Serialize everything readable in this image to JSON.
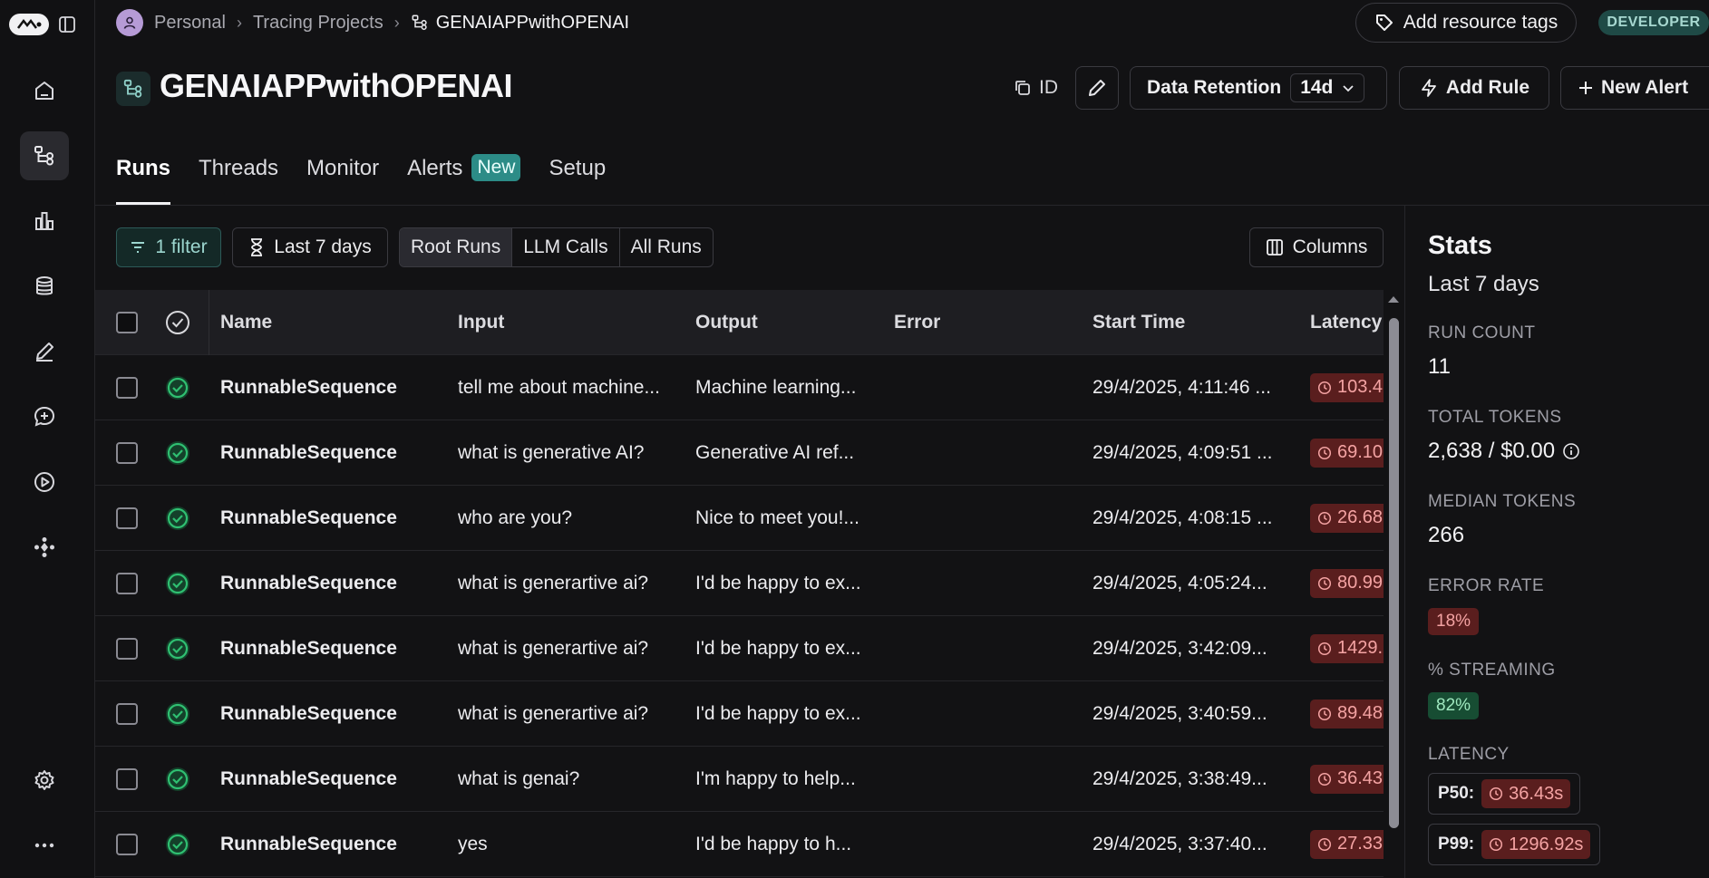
{
  "breadcrumb": {
    "workspace": "Personal",
    "section": "Tracing Projects",
    "project": "GENAIAPPwithOPENAI"
  },
  "header": {
    "resource_tags_label": "Add resource tags",
    "env_badge": "DEVELOPER",
    "title": "GENAIAPPwithOPENAI",
    "id_label": "ID",
    "retention_label": "Data Retention",
    "retention_value": "14d",
    "add_rule_label": "Add Rule",
    "new_alert_label": "New Alert"
  },
  "tabs": [
    {
      "label": "Runs",
      "active": true
    },
    {
      "label": "Threads"
    },
    {
      "label": "Monitor"
    },
    {
      "label": "Alerts",
      "badge": "New"
    },
    {
      "label": "Setup"
    }
  ],
  "toolbar": {
    "filter_label": "1 filter",
    "range_label": "Last 7 days",
    "run_types": [
      "Root Runs",
      "LLM Calls",
      "All Runs"
    ],
    "selected_run_type": "Root Runs",
    "columns_label": "Columns"
  },
  "table": {
    "columns": [
      "Name",
      "Input",
      "Output",
      "Error",
      "Start Time",
      "Latency"
    ],
    "rows": [
      {
        "name": "RunnableSequence",
        "input": "tell me about machine...",
        "output": "Machine learning...",
        "error": "",
        "start": "29/4/2025, 4:11:46 ...",
        "latency": "103.4"
      },
      {
        "name": "RunnableSequence",
        "input": "what is generative AI?",
        "output": "Generative AI ref...",
        "error": "",
        "start": "29/4/2025, 4:09:51 ...",
        "latency": "69.10"
      },
      {
        "name": "RunnableSequence",
        "input": "who are you?",
        "output": "Nice to meet you!...",
        "error": "",
        "start": "29/4/2025, 4:08:15 ...",
        "latency": "26.68"
      },
      {
        "name": "RunnableSequence",
        "input": "what is generartive ai?",
        "output": "I'd be happy to ex...",
        "error": "",
        "start": "29/4/2025, 4:05:24...",
        "latency": "80.99"
      },
      {
        "name": "RunnableSequence",
        "input": "what is generartive ai?",
        "output": "I'd be happy to ex...",
        "error": "",
        "start": "29/4/2025, 3:42:09...",
        "latency": "1429."
      },
      {
        "name": "RunnableSequence",
        "input": "what is generartive ai?",
        "output": "I'd be happy to ex...",
        "error": "",
        "start": "29/4/2025, 3:40:59...",
        "latency": "89.48"
      },
      {
        "name": "RunnableSequence",
        "input": "what is genai?",
        "output": "I'm happy to help...",
        "error": "",
        "start": "29/4/2025, 3:38:49...",
        "latency": "36.43"
      },
      {
        "name": "RunnableSequence",
        "input": "yes",
        "output": "I'd be happy to h...",
        "error": "",
        "start": "29/4/2025, 3:37:40...",
        "latency": "27.33"
      }
    ]
  },
  "stats": {
    "title": "Stats",
    "range": "Last 7 days",
    "run_count_label": "RUN COUNT",
    "run_count": "11",
    "total_tokens_label": "TOTAL TOKENS",
    "total_tokens": "2,638 / $0.00",
    "median_tokens_label": "MEDIAN TOKENS",
    "median_tokens": "266",
    "error_rate_label": "ERROR RATE",
    "error_rate": "18%",
    "streaming_label": "% STREAMING",
    "streaming": "82%",
    "latency_label": "LATENCY",
    "p50_label": "P50:",
    "p50": "36.43s",
    "p99_label": "P99:",
    "p99": "1296.92s"
  },
  "colors": {
    "background": "#121214",
    "accent_teal": "#2c8c87",
    "success_green": "#2fbf71",
    "latency_red": "#5a1e1e"
  },
  "icons": [
    "home-icon",
    "tracing-icon",
    "dashboard-icon",
    "datasets-icon",
    "annotation-icon",
    "prompts-icon",
    "playground-icon",
    "deployments-icon",
    "settings-icon",
    "more-icon"
  ]
}
